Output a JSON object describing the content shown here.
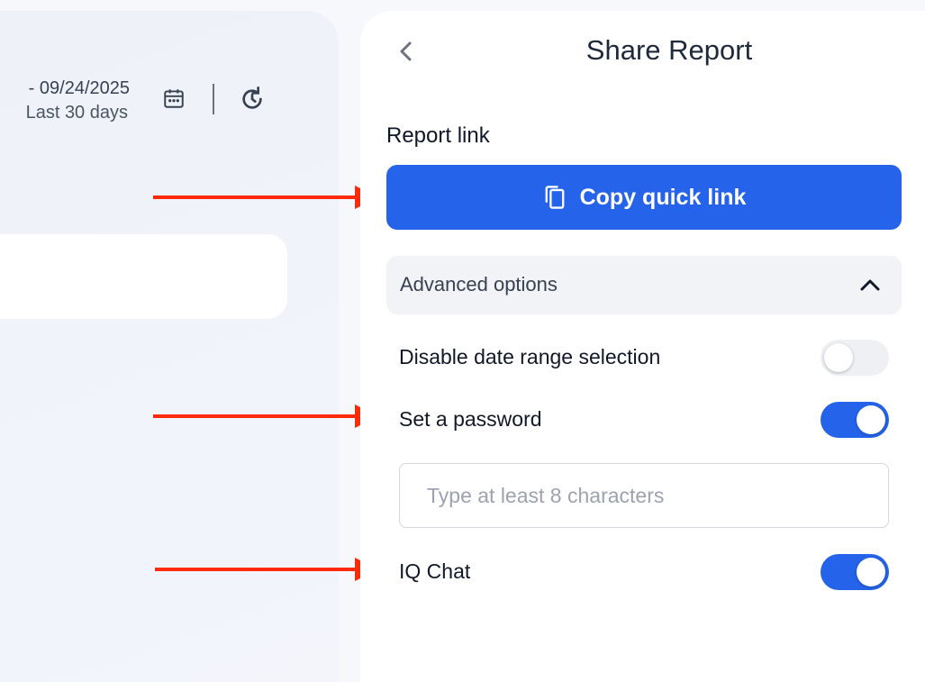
{
  "background": {
    "date_range": "- 09/24/2025",
    "date_preset": "Last 30 days",
    "icons": [
      "calendar-icon",
      "refresh-icon"
    ]
  },
  "drawer": {
    "title": "Share Report",
    "back_icon": "chevron-left-icon",
    "section_label": "Report link",
    "copy_button": {
      "label": "Copy quick link",
      "icon": "copy-icon"
    },
    "advanced": {
      "label": "Advanced options",
      "expanded": true,
      "icon": "chevron-up-icon"
    },
    "options": [
      {
        "label": "Disable date range selection",
        "enabled": false
      },
      {
        "label": "Set a password",
        "enabled": true
      },
      {
        "label": "IQ Chat",
        "enabled": true
      }
    ],
    "password": {
      "placeholder": "Type at least 8 characters",
      "value": ""
    }
  },
  "colors": {
    "accent": "#2563eb",
    "annotation_arrow": "#ff2a0a"
  }
}
